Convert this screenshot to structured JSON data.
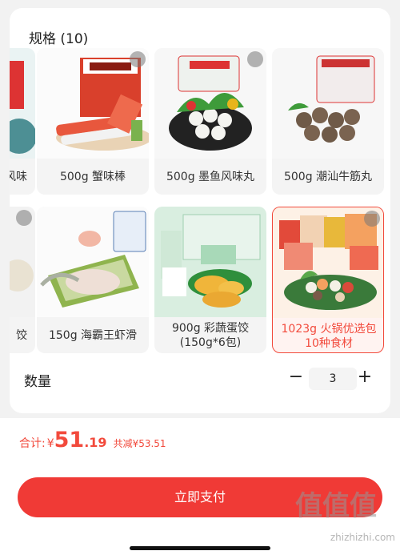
{
  "spec": {
    "title": "规格 (10)"
  },
  "row1": [
    {
      "label": "风味"
    },
    {
      "label": "500g 蟹味棒"
    },
    {
      "label": "500g 墨鱼风味丸"
    },
    {
      "label": "500g 潮汕牛筋丸"
    }
  ],
  "row2": [
    {
      "label": "饺"
    },
    {
      "label": "150g 海霸王虾滑"
    },
    {
      "label": "900g 彩蔬蛋饺 (150g*6包)"
    },
    {
      "label": "1023g 火锅优选包 10种食材"
    }
  ],
  "quantity": {
    "label": "数量",
    "minus": "−",
    "value": "3",
    "plus": "+"
  },
  "total": {
    "label": "合计:",
    "currency": "¥",
    "int": "51",
    "dec": ".19",
    "saved": "共减¥53.51"
  },
  "pay": {
    "label": "立即支付"
  },
  "watermark": {
    "text": "值值值",
    "site": "zhizhizhi.com"
  },
  "colors": {
    "accent": "#f24a3c",
    "button": "#f03a36"
  }
}
